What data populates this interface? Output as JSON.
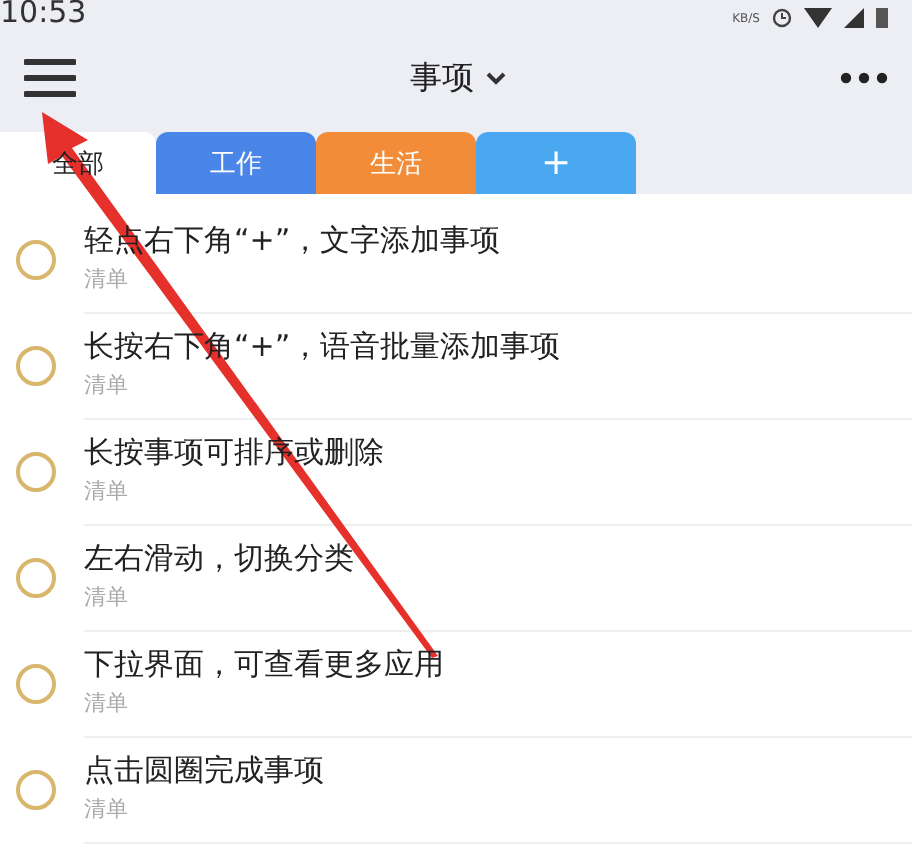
{
  "status_bar": {
    "time": "10:53",
    "speed_unit": "KB/S"
  },
  "header": {
    "title": "事项"
  },
  "tabs": [
    {
      "label": "全部",
      "selected": true,
      "color": "#ffffff"
    },
    {
      "label": "工作",
      "selected": false,
      "color": "#4a86e8"
    },
    {
      "label": "生活",
      "selected": false,
      "color": "#f28c38"
    },
    {
      "label": "+",
      "selected": false,
      "color": "#4aa8f0"
    }
  ],
  "items": [
    {
      "title": "轻点右下角“+”，文字添加事项",
      "list": "清单",
      "done": false
    },
    {
      "title": "长按右下角“+”，语音批量添加事项",
      "list": "清单",
      "done": false
    },
    {
      "title": "长按事项可排序或删除",
      "list": "清单",
      "done": false
    },
    {
      "title": "左右滑动，切换分类",
      "list": "清单",
      "done": false
    },
    {
      "title": "下拉界面，可查看更多应用",
      "list": "清单",
      "done": false
    },
    {
      "title": "点击圆圈完成事项",
      "list": "清单",
      "done": false
    }
  ]
}
